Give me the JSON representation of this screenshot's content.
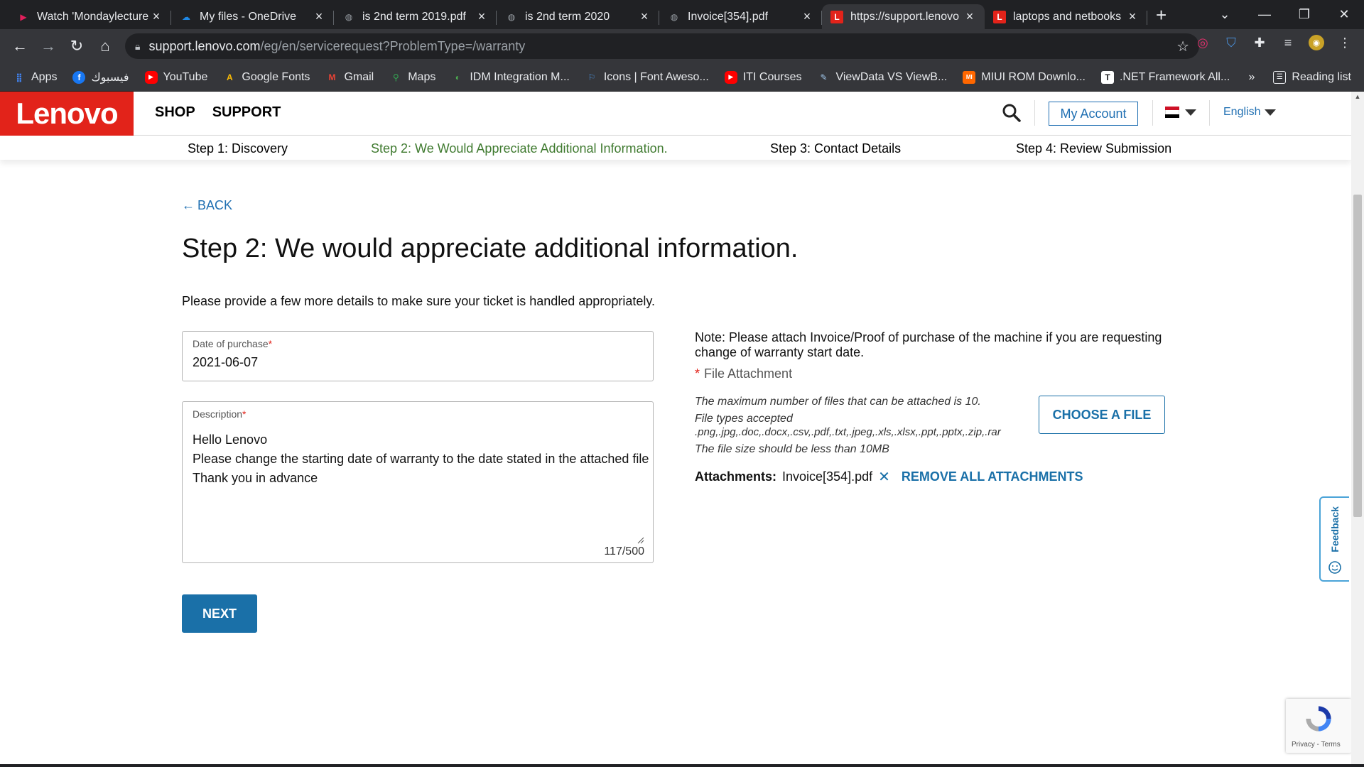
{
  "browser": {
    "tabs": [
      {
        "title": "Watch 'Mondaylecture",
        "favicon": "play-icon",
        "favicon_color": "#e21f5c",
        "active": false
      },
      {
        "title": "My files - OneDrive",
        "favicon": "cloud-icon",
        "favicon_color": "#1e88e5",
        "active": false
      },
      {
        "title": "is 2nd term 2019.pdf",
        "favicon": "globe-icon",
        "favicon_color": "#9aa0a6",
        "active": false
      },
      {
        "title": "is 2nd term 2020",
        "favicon": "globe-icon",
        "favicon_color": "#9aa0a6",
        "active": false
      },
      {
        "title": "Invoice[354].pdf",
        "favicon": "globe-icon",
        "favicon_color": "#9aa0a6",
        "active": false
      },
      {
        "title": "https://support.lenovo",
        "favicon": "lenovo-l-icon",
        "favicon_color": "#e2231a",
        "active": true
      },
      {
        "title": "laptops and netbooks",
        "favicon": "lenovo-l-icon",
        "favicon_color": "#e2231a",
        "active": false
      }
    ],
    "url_host": "support.lenovo.com",
    "url_path": "/eg/en/servicerequest?ProblemType=/warranty",
    "bookmarks": [
      {
        "label": "Apps",
        "icon": "apps-grid-icon",
        "color": "#4285f4"
      },
      {
        "label": "فيسبوك",
        "icon": "facebook-icon",
        "color": "#1877f2"
      },
      {
        "label": "YouTube",
        "icon": "youtube-icon",
        "color": "#ff0000"
      },
      {
        "label": "Google Fonts",
        "icon": "google-fonts-icon",
        "color": "#fbbc04"
      },
      {
        "label": "Gmail",
        "icon": "gmail-icon",
        "color": "#ea4335"
      },
      {
        "label": "Maps",
        "icon": "maps-pin-icon",
        "color": "#34a853"
      },
      {
        "label": "IDM Integration M...",
        "icon": "idm-icon",
        "color": "#4caf50"
      },
      {
        "label": "Icons | Font Aweso...",
        "icon": "flag-icon",
        "color": "#4a90d9"
      },
      {
        "label": "ITI Courses",
        "icon": "youtube-icon",
        "color": "#ff0000"
      },
      {
        "label": "ViewData VS ViewB...",
        "icon": "viewdata-icon",
        "color": "#9fc5e8"
      },
      {
        "label": "MIUI ROM Downlo...",
        "icon": "miui-icon",
        "color": "#ff6700"
      },
      {
        "label": ".NET Framework All...",
        "icon": "tt-icon",
        "color": "#ffffff"
      }
    ],
    "bookmarks_overflow": "»",
    "reading_list": "Reading list"
  },
  "site": {
    "logo": "Lenovo",
    "nav": [
      "SHOP",
      "SUPPORT"
    ],
    "my_account": "My Account",
    "language": "English",
    "brand_color": "#e2231a",
    "link_color": "#1f6fb2"
  },
  "steps": [
    {
      "label": "Step 1: Discovery",
      "current": false
    },
    {
      "label": "Step 2: We Would Appreciate Additional Information.",
      "current": true
    },
    {
      "label": "Step 3: Contact Details",
      "current": false
    },
    {
      "label": "Step 4: Review Submission",
      "current": false
    }
  ],
  "form": {
    "back": "BACK",
    "heading": "Step 2: We would appreciate additional information.",
    "intro": "Please provide a few more details to make sure your ticket is handled appropriately.",
    "date_label": "Date of purchase",
    "date_value": "2021-06-07",
    "required_mark": "*",
    "description_label": "Description",
    "description_value": "Hello Lenovo\nPlease change the starting date of warranty to the date stated in the attached file\nThank you in advance",
    "description_counter": "117/500",
    "next": "NEXT"
  },
  "attachment": {
    "note": "Note: Please attach Invoice/Proof of purchase of the machine if you are requesting change of warranty start date.",
    "label": "File Attachment",
    "rule_max": "The maximum number of files that can be attached is 10.",
    "rule_types_title": "File types accepted",
    "rule_types": ".png,.jpg,.doc,.docx,.csv,.pdf,.txt,.jpeg,.xls,.xlsx,.ppt,.pptx,.zip,.rar",
    "rule_size": "The file size should be less than 10MB",
    "choose": "CHOOSE A FILE",
    "attachments_label": "Attachments:",
    "file_name": "Invoice[354].pdf",
    "remove_all": "REMOVE ALL ATTACHMENTS"
  },
  "feedback": "Feedback",
  "captcha_terms": "Privacy - Terms"
}
